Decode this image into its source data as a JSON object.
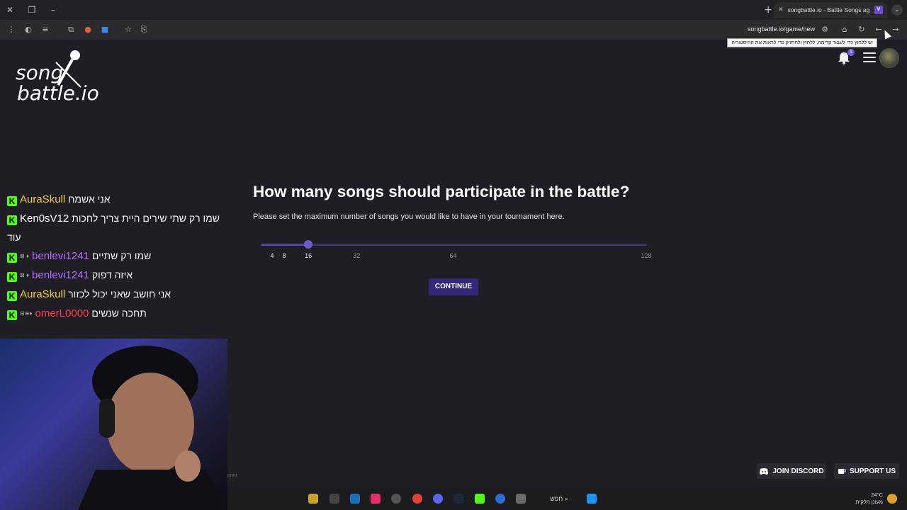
{
  "browser": {
    "tab_title": "songbattle.io - Battle Songs ag",
    "url": "songbattle.io/game/new",
    "tooltip": "יש ללחוץ כדי לעבור קדימה, ללחוץ ולהחזיק כדי לראות את ההיסטוריה"
  },
  "logo": {
    "line1": "song",
    "line2": "battle.io"
  },
  "header": {
    "notification_count": "1"
  },
  "chat": {
    "messages": [
      {
        "user": "AuraSkull",
        "user_color": "#f2c94c",
        "badges": "",
        "text": "אני אשמח"
      },
      {
        "user": "Ken0sV12",
        "user_color": "#ffffff",
        "badges": "",
        "text": "שמו רק שתי שירים היית צריך לחכות עוד"
      },
      {
        "user": "benlevi1241",
        "user_color": "#b86cff",
        "badges": "⊠ ♦",
        "text": "שמו רק שתיים"
      },
      {
        "user": "benlevi1241",
        "user_color": "#b86cff",
        "badges": "⊠ ♦",
        "text": "איזה דפוק"
      },
      {
        "user": "AuraSkull",
        "user_color": "#f2c94c",
        "badges": "",
        "text": "אני חושב שאני יכול לכזור"
      },
      {
        "user": "omerL0000",
        "user_color": "#ff3a4e",
        "badges": "⊟⊕♦",
        "text": "תחכה שנשים"
      }
    ]
  },
  "main": {
    "question": "How many songs should participate in the battle?",
    "subtext": "Please set the maximum number of songs you would like to have in your tournament here.",
    "slider": {
      "min": 4,
      "max": 128,
      "value": 16,
      "ticks": [
        "4",
        "8",
        "16",
        "32",
        "64",
        "128"
      ]
    },
    "continue_label": "CONTINUE"
  },
  "footer": {
    "imprint": "print",
    "discord_label": "JOIN DISCORD",
    "support_label": "SUPPORT US"
  },
  "taskbar": {
    "search_label": "חפש",
    "temperature": "24°C",
    "weather": "מעונן חלקית",
    "tray_badge": "1"
  },
  "colors": {
    "accent": "#6a5bd0",
    "button": "#34287a",
    "kick_green": "#53fc18"
  }
}
